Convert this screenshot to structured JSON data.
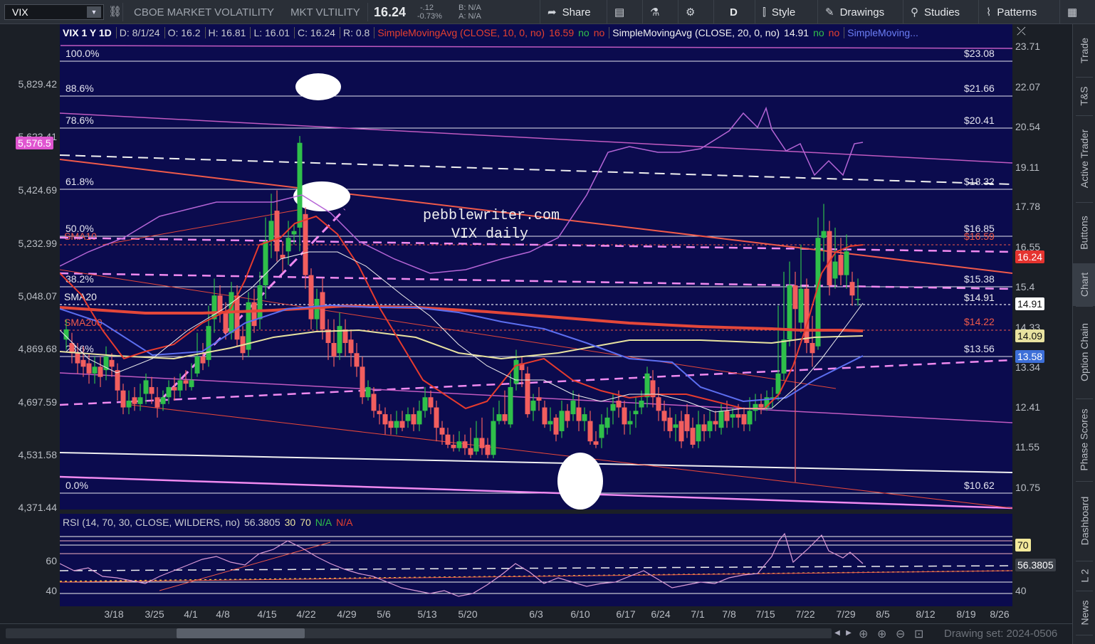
{
  "toolbar": {
    "symbol": "VIX",
    "description": "CBOE MARKET VOLATILITY",
    "short_name": "MKT VLTILITY",
    "last_price": "16.24",
    "change": "-.12",
    "change_pct": "-0.73%",
    "bid": "B: N/A",
    "ask": "A: N/A",
    "share": "Share",
    "aggregation": "D",
    "style": "Style",
    "drawings": "Drawings",
    "studies": "Studies",
    "patterns": "Patterns"
  },
  "info_bar": {
    "header": "VIX 1 Y 1D",
    "date": "D: 8/1/24",
    "open": "O: 16.2",
    "high": "H: 16.81",
    "low": "L: 16.01",
    "close": "C: 16.24",
    "range": "R: 0.8",
    "sma10": "SimpleMovingAvg (CLOSE, 10, 0, no)",
    "sma10_value": "16.59",
    "sma20": "SimpleMovingAvg (CLOSE, 20, 0, no)",
    "sma20_value": "14.91",
    "sma_more": "SimpleMoving...",
    "no": "no"
  },
  "watermark": {
    "line1": "pebblewriter.com",
    "line2": "VIX daily"
  },
  "fib_levels": [
    {
      "pct": "100.0%",
      "price": "$23.08"
    },
    {
      "pct": "88.6%",
      "price": "$21.66"
    },
    {
      "pct": "78.6%",
      "price": "$20.41"
    },
    {
      "pct": "61.8%",
      "price": "$18.32"
    },
    {
      "pct": "50.0%",
      "price": "$16.85"
    },
    {
      "pct": "38.2%",
      "price": "$15.38"
    },
    {
      "pct": "23.6%",
      "price": "$13.56"
    },
    {
      "pct": "0.0%",
      "price": "$10.62"
    }
  ],
  "overlay_labels": {
    "sma10_tag": "SMA10",
    "sma20_tag": "SMA20",
    "sma200_tag": "SMA200",
    "sma10_price": "$16.59",
    "sma20_price": "$14.91",
    "sma200_price": "$14.22"
  },
  "left_axis": [
    "5,829.42",
    "5,623.41",
    "5,424.69",
    "5,232.99",
    "5,048.07",
    "4,869.68",
    "4,697.59",
    "4,531.58",
    "4,371.44"
  ],
  "left_tag": "5,576.5",
  "right_axis": [
    "23.71",
    "22.07",
    "20.54",
    "19.11",
    "17.78",
    "16.55",
    "15.4",
    "14.33",
    "13.34",
    "12.41",
    "11.55",
    "10.75"
  ],
  "right_tags": {
    "last": "16.24",
    "sma20": "14.91",
    "sma50": "14.09",
    "other": "13.58"
  },
  "rsi": {
    "header": "RSI (14, 70, 30, CLOSE, WILDERS, no)",
    "value": "56.3805",
    "ob": "30",
    "os": "70",
    "na1": "N/A",
    "na2": "N/A",
    "axis_60": "60",
    "axis_40": "40",
    "tag_70": "70",
    "tag_value": "56.3805",
    "tag_40": "40"
  },
  "x_axis": [
    "3/18",
    "3/25",
    "4/1",
    "4/8",
    "4/15",
    "4/22",
    "4/29",
    "5/6",
    "5/13",
    "5/20",
    "6/3",
    "6/10",
    "6/17",
    "6/24",
    "7/1",
    "7/8",
    "7/15",
    "7/22",
    "7/29",
    "8/5",
    "8/12",
    "8/19",
    "8/26"
  ],
  "drawing_set": "Drawing set: 2024-0506",
  "side_tabs": [
    "Trade",
    "T&S",
    "Active Trader",
    "Buttons",
    "Chart",
    "Option Chain",
    "Phase Scores",
    "Dashboard",
    "L 2",
    "News"
  ],
  "colors": {
    "background": "#0b0b4e",
    "up_candle": "#2fbf4a",
    "down_candle": "#f25e5e",
    "sma10": "#e63b2e",
    "sma200": "#e4473a",
    "sma50": "#e8e2a0",
    "sma_blue": "#5c6ef0",
    "trend_magenta": "#e07ad8",
    "last_tag": "#e5332f",
    "blue_tag": "#3d6fd8",
    "left_tag": "#e055d0"
  }
}
